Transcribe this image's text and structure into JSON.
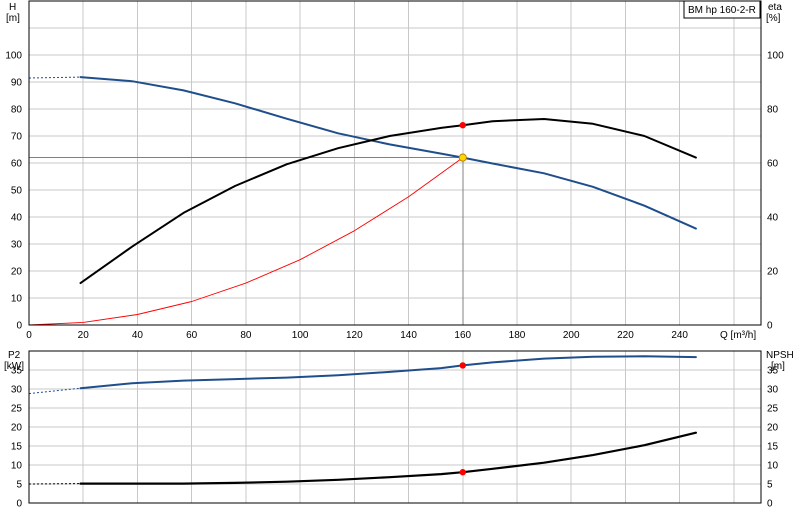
{
  "legend_label": "BM hp 160-2-R",
  "chart_data": [
    {
      "type": "line",
      "title": "",
      "x_label": "Q [m³/h]",
      "x_ticks": [
        "0",
        "20",
        "40",
        "60",
        "80",
        "100",
        "120",
        "140",
        "160",
        "180",
        "200",
        "220",
        "240"
      ],
      "xlim": [
        0,
        270
      ],
      "left_axis": {
        "label": "H",
        "unit": "[m]",
        "ylim": [
          0,
          120
        ],
        "ticks": [
          "0",
          "10",
          "20",
          "30",
          "40",
          "50",
          "60",
          "70",
          "80",
          "90",
          "100"
        ]
      },
      "right_axis": {
        "label": "eta",
        "unit": "[%]",
        "ylim": [
          0,
          120
        ],
        "ticks": [
          "0",
          "20",
          "40",
          "60",
          "80",
          "100"
        ]
      },
      "duty_point": {
        "x": 160,
        "head": 62,
        "eta": 74
      },
      "series": [
        {
          "id": "head",
          "axis": "left",
          "color": "#1f4e8c",
          "style": "solid",
          "extrapolation": [
            [
              0,
              91.5
            ],
            [
              19,
              91.8
            ]
          ],
          "x": [
            19,
            38,
            57,
            76,
            95,
            114,
            133,
            152,
            160,
            171,
            190,
            208,
            227,
            246
          ],
          "y": [
            91.8,
            90.3,
            86.9,
            82.1,
            76.4,
            71.0,
            66.9,
            63.5,
            62.0,
            59.8,
            56.2,
            51.2,
            44.2,
            35.7
          ]
        },
        {
          "id": "system",
          "axis": "left",
          "color": "#ff0000",
          "style": "thin",
          "x": [
            0,
            20,
            40,
            60,
            80,
            100,
            120,
            140,
            160
          ],
          "y": [
            0,
            0.97,
            3.9,
            8.7,
            15.5,
            24.2,
            34.9,
            47.5,
            62.0
          ]
        },
        {
          "id": "eta",
          "axis": "right",
          "color": "#000000",
          "style": "solid",
          "x": [
            19,
            38,
            57,
            76,
            95,
            114,
            133,
            152,
            160,
            171,
            190,
            208,
            227,
            246
          ],
          "y": [
            15.5,
            29.0,
            41.5,
            51.5,
            59.5,
            65.5,
            70.0,
            73.0,
            74.0,
            75.5,
            76.3,
            74.5,
            70.0,
            62.0
          ]
        }
      ]
    },
    {
      "type": "line",
      "title": "",
      "x_label": "",
      "xlim": [
        0,
        270
      ],
      "left_axis": {
        "label": "P2",
        "unit": "[kW]",
        "ylim": [
          0,
          40
        ],
        "ticks": [
          "0",
          "5",
          "10",
          "15",
          "20",
          "25",
          "30",
          "35"
        ]
      },
      "right_axis": {
        "label": "NPSH",
        "unit": "[m]",
        "ylim": [
          0,
          40
        ],
        "ticks": [
          "0",
          "5",
          "10",
          "15",
          "20",
          "25",
          "30",
          "35"
        ]
      },
      "duty_point": {
        "x": 160,
        "power": 36.2,
        "npsh": 8.1
      },
      "series": [
        {
          "id": "power",
          "axis": "left",
          "color": "#1f4e8c",
          "style": "solid",
          "extrapolation": [
            [
              0,
              28.8
            ],
            [
              19,
              30.2
            ]
          ],
          "x": [
            19,
            38,
            57,
            76,
            95,
            114,
            133,
            152,
            160,
            171,
            190,
            208,
            227,
            246
          ],
          "y": [
            30.2,
            31.5,
            32.2,
            32.6,
            33.0,
            33.6,
            34.5,
            35.5,
            36.2,
            37.0,
            38.0,
            38.5,
            38.6,
            38.4
          ]
        },
        {
          "id": "npsh",
          "axis": "right",
          "color": "#000000",
          "style": "thick",
          "extrapolation": [
            [
              0,
              5.0
            ],
            [
              19,
              5.1
            ]
          ],
          "x": [
            19,
            38,
            57,
            76,
            95,
            114,
            133,
            152,
            160,
            171,
            190,
            208,
            227,
            246
          ],
          "y": [
            5.1,
            5.1,
            5.1,
            5.3,
            5.6,
            6.1,
            6.8,
            7.6,
            8.1,
            9.0,
            10.6,
            12.6,
            15.2,
            18.5
          ]
        }
      ]
    }
  ]
}
